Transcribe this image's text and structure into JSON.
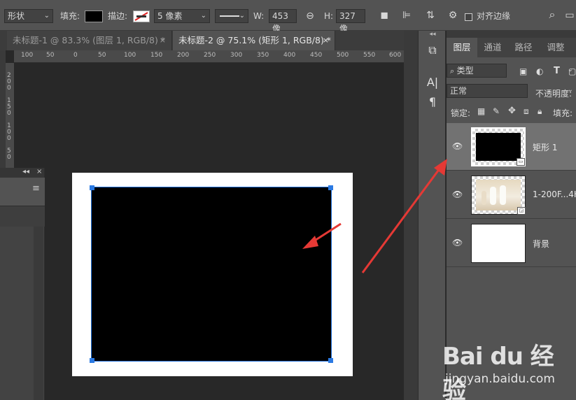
{
  "options_bar": {
    "mode_select": "形状",
    "fill_label": "填充:",
    "stroke_label": "描边:",
    "stroke_width": "5 像素",
    "w_label": "W:",
    "w_value": "453 像",
    "h_label": "H:",
    "h_value": "327 像",
    "align_edges_label": "对齐边缘"
  },
  "tabs": [
    {
      "label": "未标题-1 @ 83.3% (图层 1, RGB/8) *",
      "close": "×"
    },
    {
      "label": "未标题-2 @ 75.1% (矩形 1, RGB/8) *",
      "close": "×"
    }
  ],
  "h_ruler": [
    "100",
    "50",
    "0",
    "50",
    "100",
    "150",
    "200",
    "250",
    "300",
    "350",
    "400",
    "450",
    "500",
    "550",
    "600"
  ],
  "v_ruler": [
    "200",
    "150",
    "100",
    "50"
  ],
  "layers_panel": {
    "tabs": [
      "图层",
      "通道",
      "路径",
      "调整"
    ],
    "filter_label": "类型",
    "blend_mode": "正常",
    "opacity_label": "不透明度:",
    "lock_label": "锁定:",
    "fill_label": "填充:",
    "layers": [
      {
        "name": "矩形 1",
        "selected": true
      },
      {
        "name": "1-200F...4H5",
        "selected": false
      },
      {
        "name": "背景",
        "selected": false
      }
    ]
  },
  "watermark": {
    "logo": "Bai du 经验",
    "url": "jingyan.baidu.com"
  },
  "colors": {
    "panel": "#535353",
    "canvas_bg": "#282828",
    "selection": "#2b7ae3",
    "arrow": "#e53935"
  }
}
